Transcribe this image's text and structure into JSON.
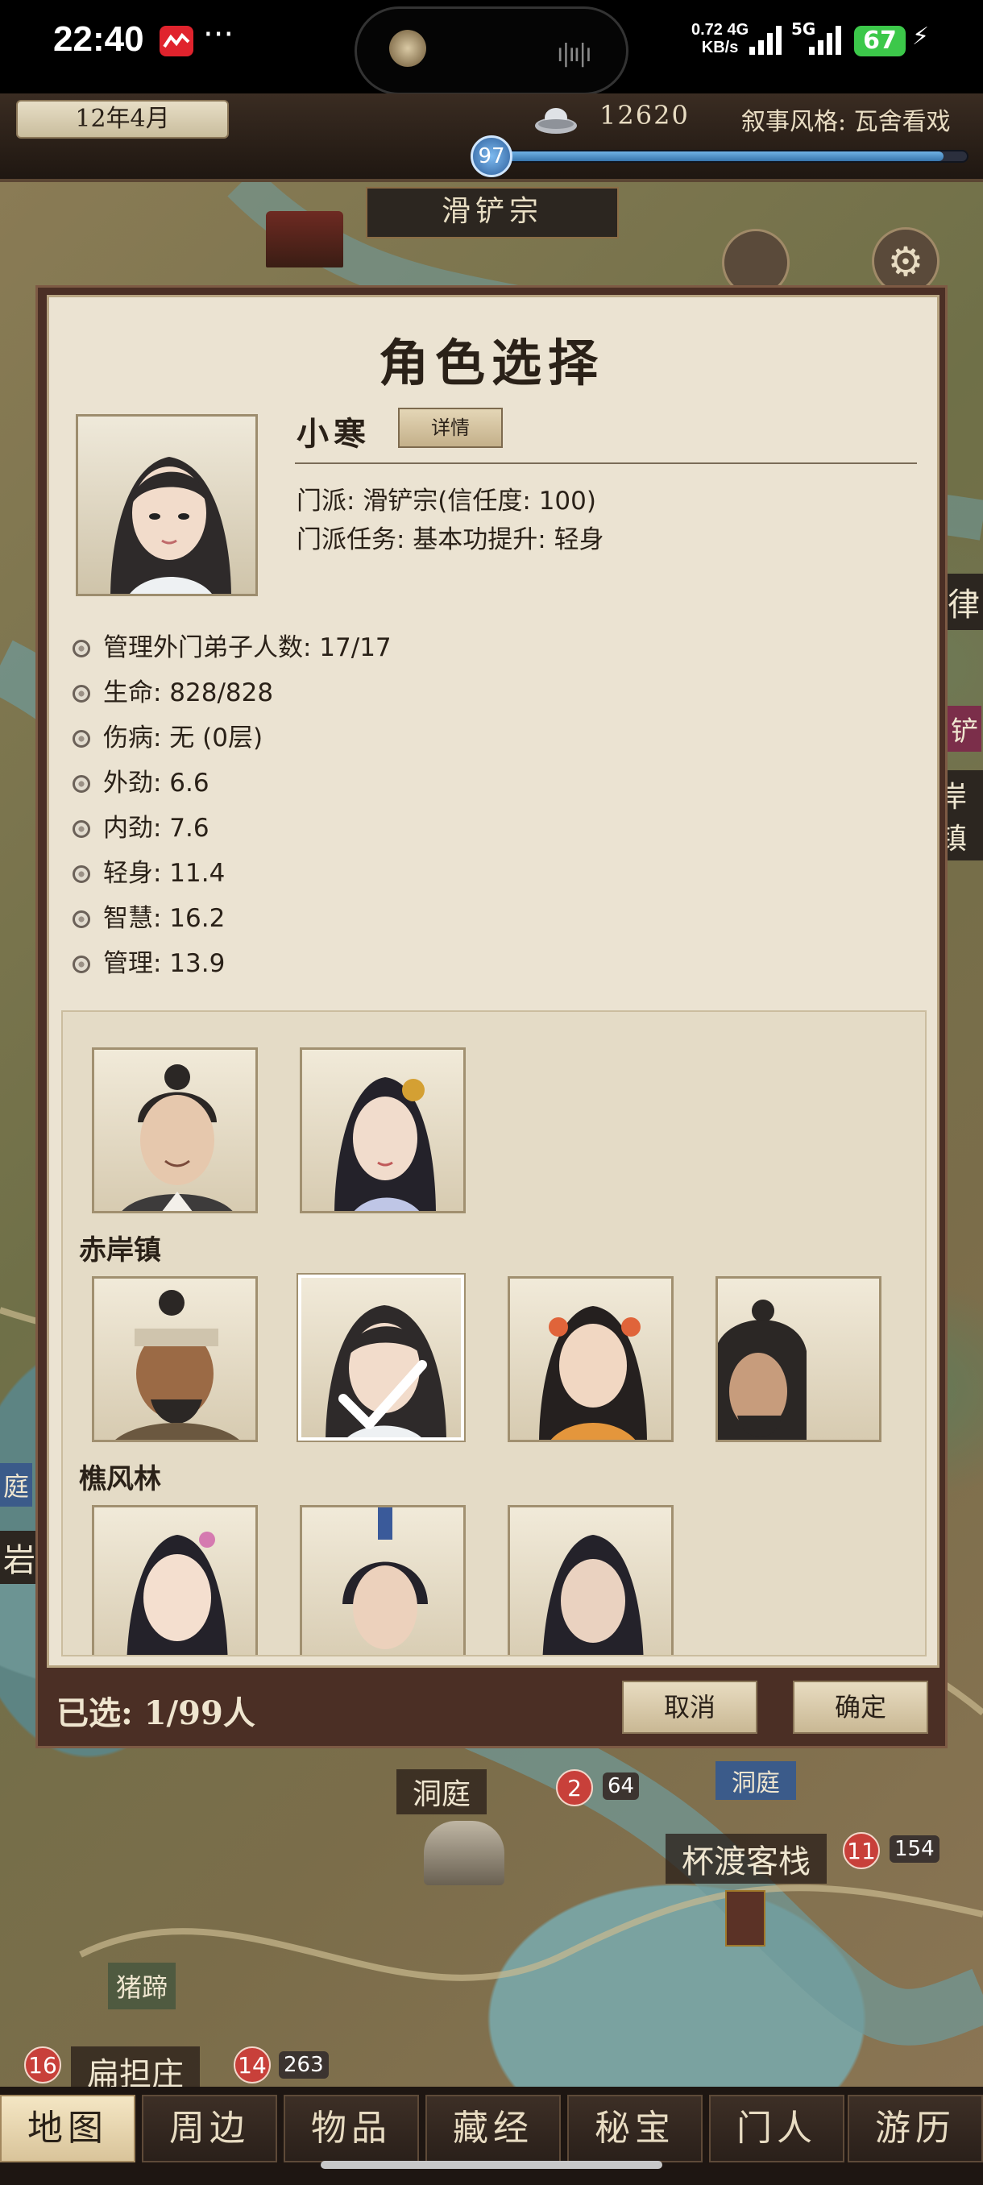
{
  "status_bar": {
    "time": "22:40",
    "network_speed_value": "0.72",
    "network_type": "4G",
    "network_speed_unit": "KB/s",
    "network_type_2": "5G",
    "battery": "67"
  },
  "top_bar": {
    "date": "12年4月",
    "money": "12620",
    "narrative_style": "叙事风格: 瓦舍看戏",
    "level": "97",
    "level_progress": 0.95
  },
  "map": {
    "sect_banner": "滑铲宗",
    "labels": [
      {
        "text": "洞庭",
        "badge": "2",
        "mark": "64"
      },
      {
        "text": "杯渡客栈",
        "badge": "11",
        "mark": "154"
      },
      {
        "text": "扁担庄",
        "badge": "14",
        "mark": "263"
      }
    ],
    "left_badge": "16",
    "small_tags": [
      "猪蹄",
      "洞庭"
    ],
    "edge_fragments": [
      "律",
      "铲",
      "岸镇",
      "庭",
      "岩"
    ]
  },
  "dialog": {
    "title": "角色选择",
    "character": {
      "name": "小寒",
      "details_button": "详情",
      "sect": "门派: 滑铲宗(信任度: 100)",
      "sect_task": "门派任务: 基本功提升: 轻身"
    },
    "stats": [
      "管理外门弟子人数: 17/17",
      "生命: 828/828",
      "伤病: 无 (0层)",
      "外劲: 6.6",
      "内劲: 7.6",
      "轻身: 11.4",
      "智慧: 16.2",
      "管理: 13.9"
    ],
    "groups": [
      {
        "name": "",
        "count": 2
      },
      {
        "name": "赤岸镇",
        "count": 4,
        "selected_index": 1
      },
      {
        "name": "樵风林",
        "count": 3
      }
    ],
    "selected_count": "已选: 1/99人",
    "cancel_button": "取消",
    "confirm_button": "确定"
  },
  "bottom_nav": {
    "items": [
      "地图",
      "周边",
      "物品",
      "藏经",
      "秘宝",
      "门人",
      "游历"
    ],
    "active": 0
  },
  "colors": {
    "dialog_frame": "#4b2f25",
    "panel_bg": "#ebe3d2",
    "nav_active": "#f4e6c4",
    "badge": "#c8403a",
    "xp_bar": "#3876ad"
  }
}
